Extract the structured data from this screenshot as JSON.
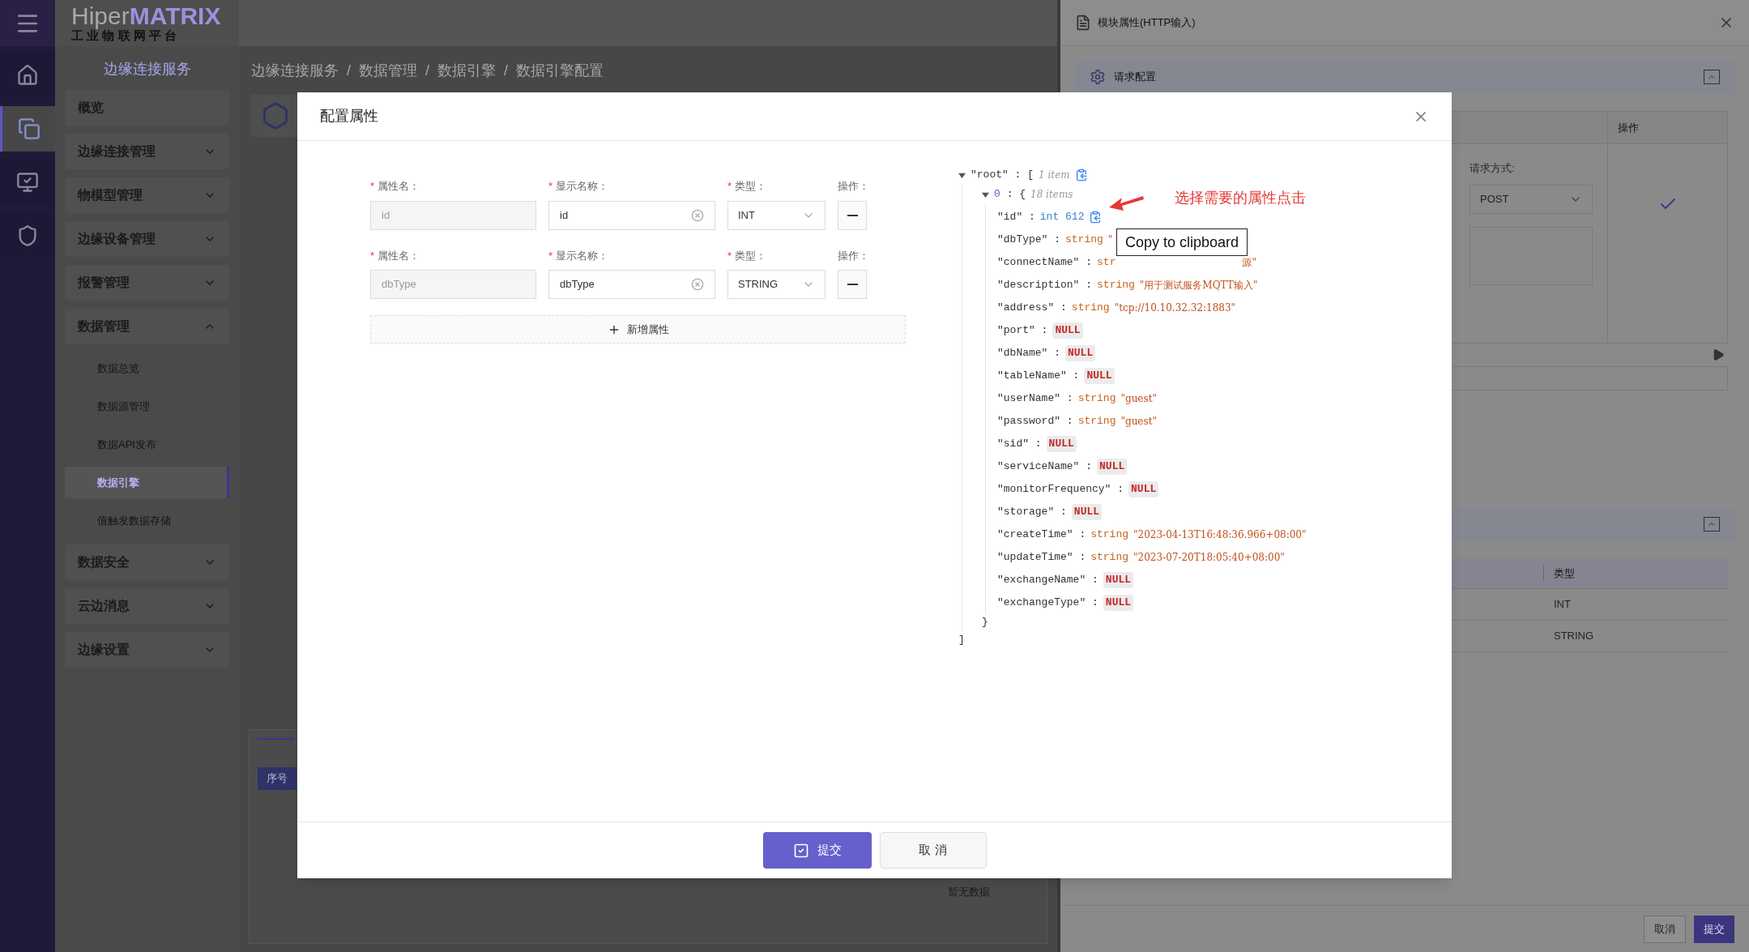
{
  "rail": {
    "items": [
      {
        "kind": "home",
        "selected": false
      },
      {
        "kind": "modules",
        "selected": true
      },
      {
        "kind": "monitor",
        "selected": false
      },
      {
        "kind": "security",
        "selected": false
      }
    ]
  },
  "logo": {
    "prefix": "Hiper",
    "emphasis": "MATRIX",
    "subtitle": "工 业 物 联 网 平 台"
  },
  "sidebar": {
    "title": "边缘连接服务",
    "items": [
      {
        "label": "概览",
        "kind": "link"
      },
      {
        "label": "边缘连接管理",
        "kind": "group",
        "expanded": false
      },
      {
        "label": "物模型管理",
        "kind": "group",
        "expanded": false
      },
      {
        "label": "边缘设备管理",
        "kind": "group",
        "expanded": false
      },
      {
        "label": "报警管理",
        "kind": "group",
        "expanded": false
      },
      {
        "label": "数据管理",
        "kind": "group",
        "expanded": true,
        "children": [
          {
            "label": "数据总览",
            "selected": false
          },
          {
            "label": "数据源管理",
            "selected": false
          },
          {
            "label": "数据API发布",
            "selected": false
          },
          {
            "label": "数据引擎",
            "selected": true
          },
          {
            "label": "值触发数据存储",
            "selected": false
          }
        ]
      },
      {
        "label": "数据安全",
        "kind": "group",
        "expanded": false
      },
      {
        "label": "云边消息",
        "kind": "group",
        "expanded": false
      },
      {
        "label": "边缘设置",
        "kind": "group",
        "expanded": false
      }
    ]
  },
  "breadcrumb": {
    "separator": "/",
    "items": [
      "边缘连接服务",
      "数据管理",
      "数据引擎",
      "数据引擎配置"
    ]
  },
  "page": {
    "table_header": "序号",
    "empty_text": "暂无数据"
  },
  "drawer": {
    "title": "模块属性(HTTP输入)",
    "request_section": {
      "title": "请求配置",
      "expanded": true,
      "column": "操作",
      "method_label": "请求方式:",
      "method": "POST"
    },
    "second_section": {
      "expanded": true,
      "column": "类型",
      "rows": [
        "INT",
        "STRING"
      ]
    },
    "buttons": [
      {
        "label": "取消",
        "kind": "secondary"
      },
      {
        "label": "提交",
        "kind": "primary"
      }
    ]
  },
  "modal": {
    "title": "配置属性",
    "attributes": [
      {
        "labels": [
          {
            "mark": "*",
            "text": "属性名："
          },
          {
            "mark": "*",
            "text": "显示名称："
          },
          {
            "mark": "*",
            "text": "类型："
          },
          {
            "text": "操作："
          }
        ],
        "name": "id",
        "display": "id",
        "type": "INT"
      },
      {
        "labels": [
          {
            "mark": "*",
            "text": "属性名："
          },
          {
            "mark": "*",
            "text": "显示名称："
          },
          {
            "mark": "*",
            "text": "类型："
          },
          {
            "text": "操作："
          }
        ],
        "name": "dbType",
        "display": "dbType",
        "type": "STRING"
      }
    ],
    "add_button": "新增属性",
    "tree": {
      "root": {
        "key": "\"root\" : [",
        "count": "1 item",
        "expanded": true
      },
      "item": {
        "index": "0",
        "rest": ": {",
        "count": "18 items",
        "expanded": true
      },
      "rows": [
        {
          "key": "\"id\" :",
          "kind": "int",
          "type": "int",
          "value": "612",
          "copy": true
        },
        {
          "key": "\"dbType\" :",
          "kind": "string",
          "type": "string",
          "value": "\""
        },
        {
          "key": "\"connectName\" :",
          "kind": "occluded",
          "type": "str",
          "value": "源\""
        },
        {
          "key": "\"description\" :",
          "kind": "string",
          "type": "string",
          "value": "\"用于测试服务MQTT输入\""
        },
        {
          "key": "\"address\" :",
          "kind": "string",
          "type": "string",
          "value": "\"tcp://10.10.32.32:1883\""
        },
        {
          "key": "\"port\" :",
          "kind": "null",
          "value": "NULL"
        },
        {
          "key": "\"dbName\" :",
          "kind": "null",
          "value": "NULL"
        },
        {
          "key": "\"tableName\" :",
          "kind": "null",
          "value": "NULL"
        },
        {
          "key": "\"userName\" :",
          "kind": "string",
          "type": "string",
          "value": "\"guest\""
        },
        {
          "key": "\"password\" :",
          "kind": "string",
          "type": "string",
          "value": "\"guest\""
        },
        {
          "key": "\"sid\" :",
          "kind": "null",
          "value": "NULL"
        },
        {
          "key": "\"serviceName\" :",
          "kind": "null",
          "value": "NULL"
        },
        {
          "key": "\"monitorFrequency\" :",
          "kind": "null",
          "value": "NULL"
        },
        {
          "key": "\"storage\" :",
          "kind": "null",
          "value": "NULL"
        },
        {
          "key": "\"createTime\" :",
          "kind": "string",
          "type": "string",
          "value": "\"2023-04-13T16:48:36.966+08:00\""
        },
        {
          "key": "\"updateTime\" :",
          "kind": "string",
          "type": "string",
          "value": "\"2023-07-20T18:05:40+08:00\""
        },
        {
          "key": "\"exchangeName\" :",
          "kind": "null",
          "value": "NULL"
        },
        {
          "key": "\"exchangeType\" :",
          "kind": "null",
          "value": "NULL"
        }
      ],
      "item_close": "}",
      "root_close": "]"
    },
    "tooltip": "Copy to clipboard",
    "annotation": "选择需要的属性点击",
    "submit": "提交",
    "cancel": "取 消"
  }
}
